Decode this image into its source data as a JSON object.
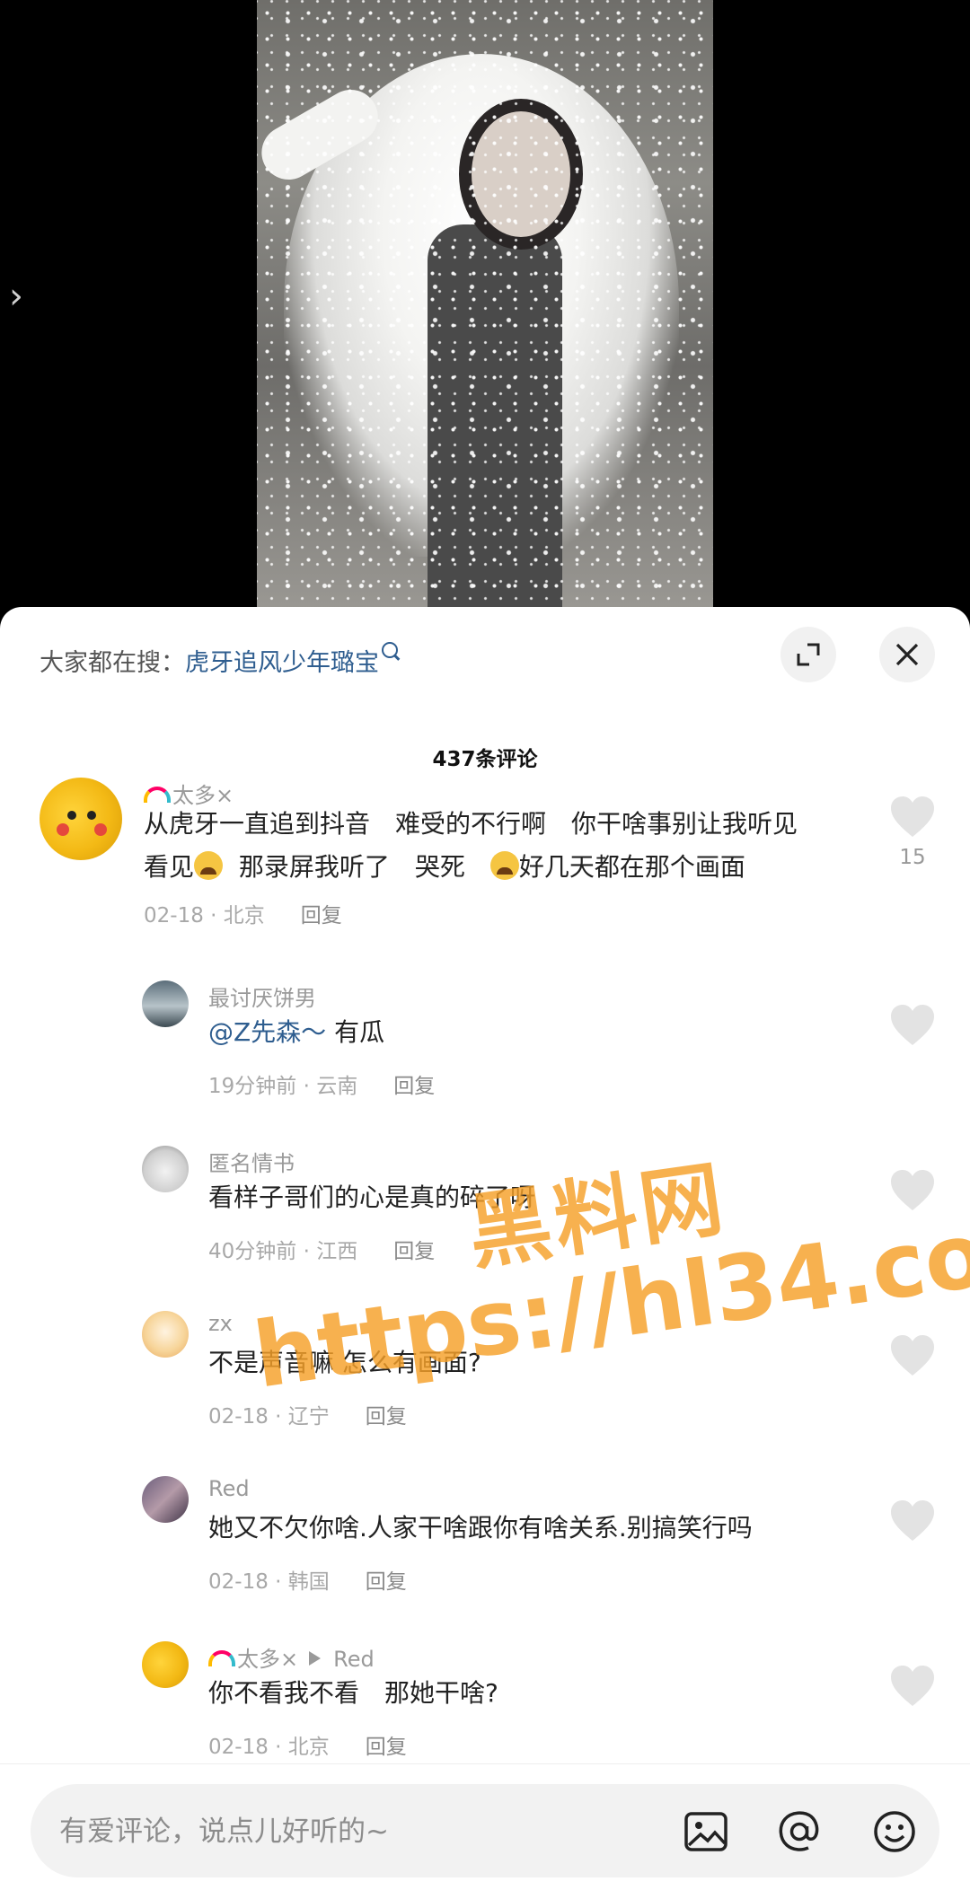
{
  "header": {
    "search_prefix": "大家都在搜：",
    "search_keyword": "虎牙追风少年璐宝"
  },
  "comments_count": "437条评论",
  "comments": [
    {
      "name": "太多×",
      "line1": "从虎牙一直追到抖音　难受的不行啊　你干啥事别让我听见",
      "line2a": "看见",
      "line2b": "那录屏我听了　哭死　",
      "line2c": "好几天都在那个画面",
      "meta": "02-18 · 北京",
      "reply": "回复",
      "likes": "15"
    },
    {
      "name": "最讨厌饼男",
      "mention": "@Z先森～",
      "text": " 有瓜",
      "meta": "19分钟前 · 云南",
      "reply": "回复"
    },
    {
      "name": "匿名情书",
      "text": "看样子哥们的心是真的碎了呀",
      "meta": "40分钟前 · 江西",
      "reply": "回复"
    },
    {
      "name": "zx",
      "text": "不是声音嘛 怎么有画面?",
      "meta": "02-18 · 辽宁",
      "reply": "回复"
    },
    {
      "name": "Red",
      "text": "她又不欠你啥.人家干啥跟你有啥关系.别搞笑行吗",
      "meta": "02-18 · 韩国",
      "reply": "回复"
    },
    {
      "name": "太多×",
      "reply_to": "Red",
      "text": "你不看我不看　那她干啥?",
      "meta": "02-18 · 北京",
      "reply": "回复"
    }
  ],
  "watermark": {
    "line1": "黑料网",
    "line2": "https://hl34.co"
  },
  "input": {
    "placeholder": "有爱评论，说点儿好听的~"
  },
  "colors": {
    "link": "#2e5d8f",
    "watermark": "#f5a028"
  }
}
